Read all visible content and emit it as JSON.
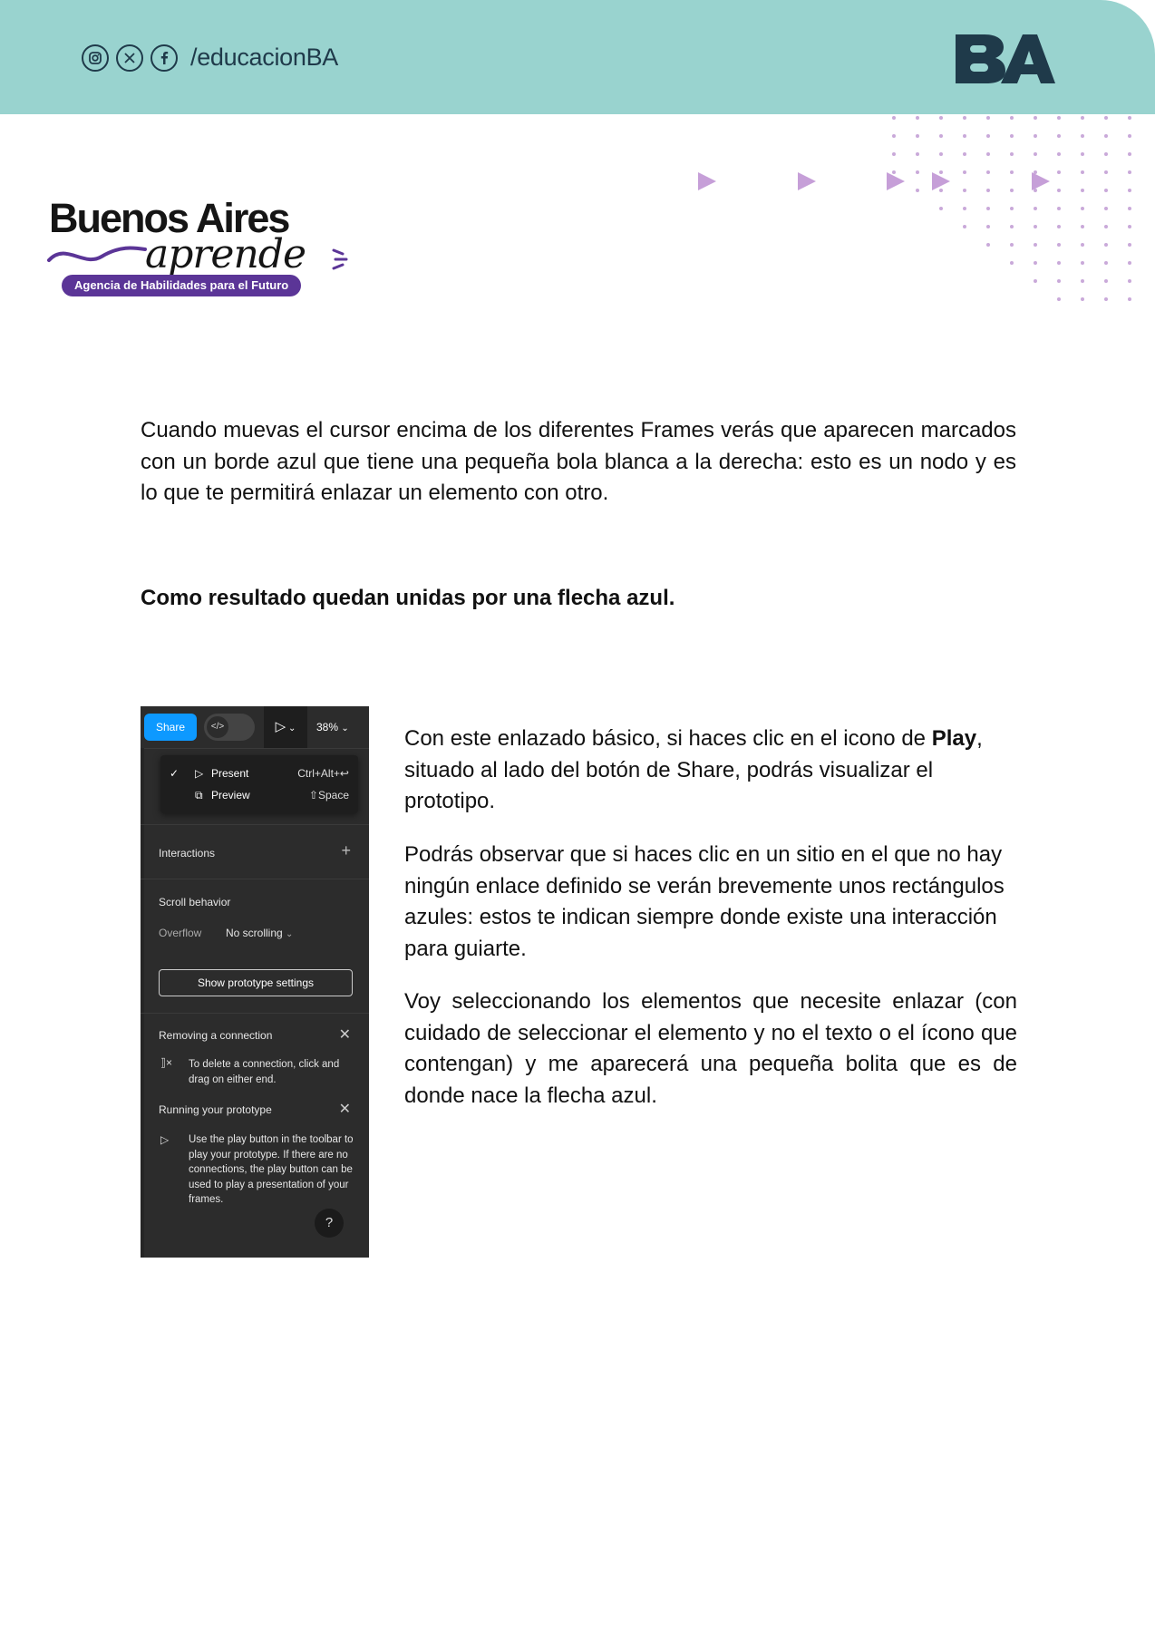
{
  "header": {
    "social_icons": [
      "instagram-icon",
      "x-icon",
      "facebook-icon"
    ],
    "handle": "/educacionBA",
    "logo_text": "BA",
    "band_color": "#99d3cf"
  },
  "brand": {
    "title": "Buenos Aires",
    "script": "aprende",
    "tagline": "Agencia de Habilidades para el Futuro",
    "accent_color": "#5b3597"
  },
  "body": {
    "paragraph1": "Cuando muevas el cursor encima de los diferentes Frames verás que aparecen marcados con un borde azul que tiene una pequeña bola blanca a la derecha: esto es un nodo y es lo que te permitirá enlazar un elemento con otro.",
    "heading": "Como resultado quedan unidas por una flecha azul.",
    "col1_pre": "Con este enlazado básico, si haces clic en el icono de ",
    "col1_bold": "Play",
    "col1_post": ", situado al lado del botón de Share, podrás visualizar el prototipo.",
    "col2": "Podrás observar que si haces clic en un sitio en el que no hay ningún enlace definido se verán brevemente unos rectángulos azules: estos te indican siempre donde existe una interacción para guiarte.",
    "col3": "Voy seleccionando los elementos que necesite enlazar (con cuidado de seleccionar el elemento y no el texto o el ícono que contengan) y me aparecerá una pequeña bolita que es de donde nace la flecha azul."
  },
  "screenshot": {
    "share": "Share",
    "zoom": "38%",
    "menu": [
      {
        "label": "Present",
        "shortcut": "Ctrl+Alt+↩"
      },
      {
        "label": "Preview",
        "shortcut": "⇧Space"
      }
    ],
    "interactions": "Interactions",
    "scroll_behavior": "Scroll behavior",
    "overflow_label": "Overflow",
    "overflow_value": "No scrolling",
    "show_settings": "Show prototype settings",
    "removing_title": "Removing a connection",
    "removing_text": "To delete a connection, click and drag on either end.",
    "running_title": "Running your prototype",
    "running_text": "Use the play button in the toolbar to play your prototype. If there are no connections, the play button can be used to play a presentation of your frames.",
    "help": "?",
    "share_color": "#0d99ff"
  }
}
